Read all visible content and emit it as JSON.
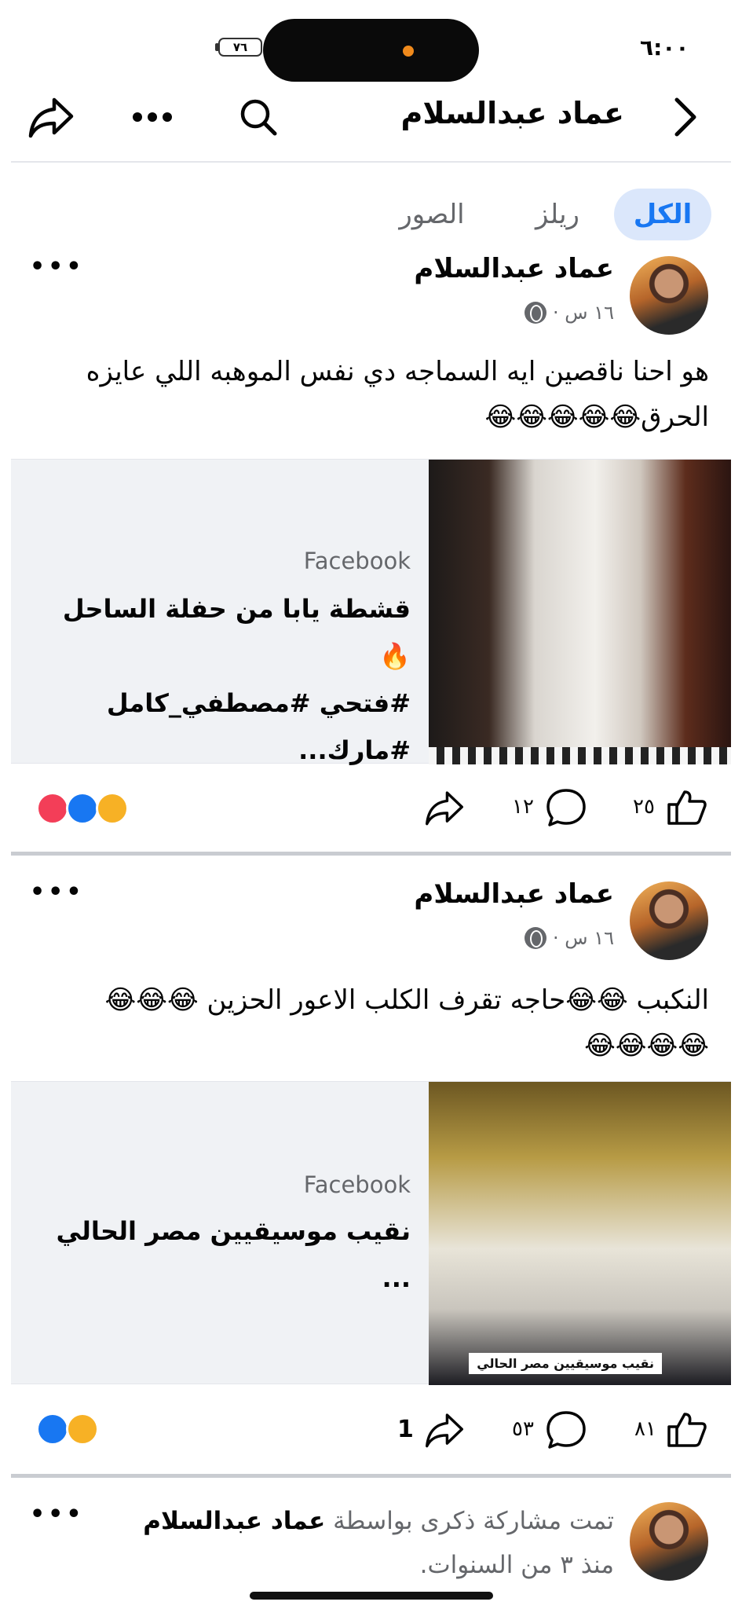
{
  "status_bar": {
    "time": "٦:٠٠",
    "battery": "٧٦"
  },
  "header": {
    "title": "عماد عبدالسلام",
    "icons": [
      "back-chevron-icon",
      "search-icon",
      "more-icon",
      "share-icon"
    ]
  },
  "tabs": [
    {
      "label": "الكل",
      "active": true
    },
    {
      "label": "ريلز",
      "active": false
    },
    {
      "label": "الصور",
      "active": false
    }
  ],
  "posts": [
    {
      "author": "عماد عبدالسلام",
      "time": "١٦ س ·",
      "text_line1": "هو احنا ناقصين ايه السماجه دي نفس الموهبه اللي عايزه",
      "text_line2": "الحرق😂😂😂😂😂",
      "link_source": "Facebook",
      "link_title_line1": "قشطة يابا من حفلة الساحل 🔥",
      "link_title_line2": "#فتحي #مصطفي_كامل #مارك...",
      "likes": "٢٥",
      "comments": "١٢",
      "shares": "",
      "reactions": [
        "haha",
        "like",
        "love"
      ]
    },
    {
      "author": "عماد عبدالسلام",
      "time": "١٦ س ·",
      "text_line1": "النكبب 😂😂حاجه تقرف الكلب الاعور الحزين 😂😂😂",
      "text_line2": "😂😂😂😂",
      "link_source": "Facebook",
      "link_title_line1": "نقيب موسيقيين مصر الحالي",
      "link_title_line2": "...",
      "image_caption": "نقيب موسيقيين مصر الحالي",
      "likes": "٨١",
      "comments": "٥٣",
      "shares": "1",
      "reactions": [
        "haha",
        "like"
      ]
    },
    {
      "text_prefix": "تمت مشاركة ذكرى بواسطة ",
      "author": "عماد عبدالسلام",
      "text_suffix": "منذ ٣ من السنوات."
    }
  ]
}
